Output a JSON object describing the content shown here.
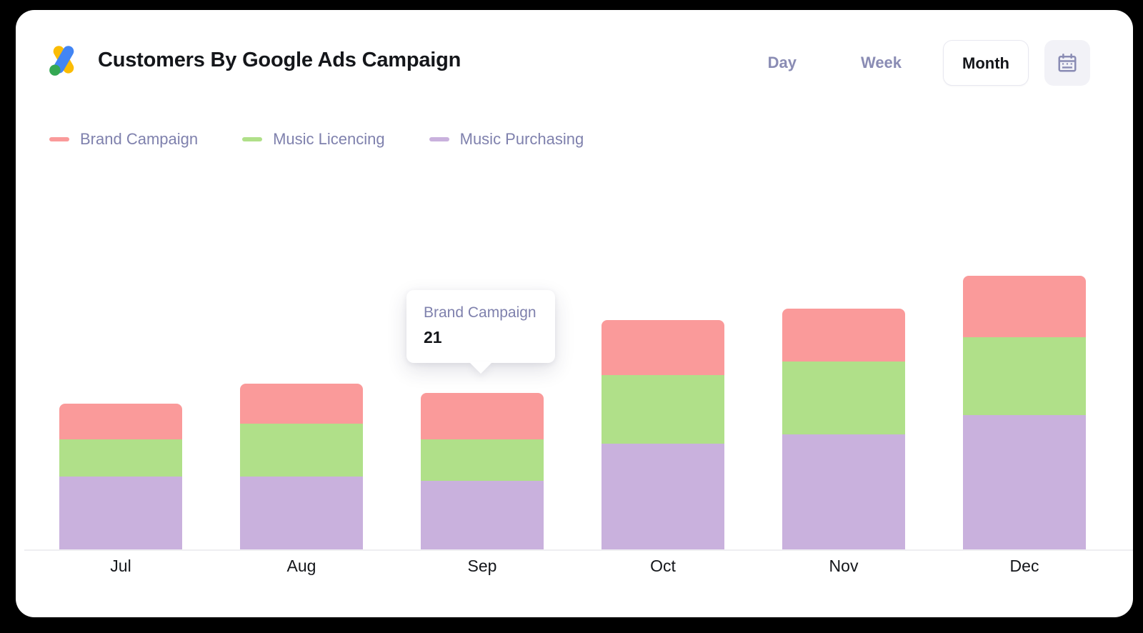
{
  "header": {
    "title": "Customers By Google Ads Campaign",
    "logo_icon": "google-ads-icon",
    "ranges": [
      {
        "label": "Day",
        "active": false
      },
      {
        "label": "Week",
        "active": false
      },
      {
        "label": "Month",
        "active": true
      }
    ],
    "calendar_icon": "calendar-icon"
  },
  "legend": [
    {
      "label": "Brand Campaign",
      "color": "#fa9a9a"
    },
    {
      "label": "Music Licencing",
      "color": "#b0e089"
    },
    {
      "label": "Music Purchasing",
      "color": "#c9b1dd"
    }
  ],
  "tooltip": {
    "series": "Brand Campaign",
    "value": "21",
    "anchor_category": "Sep"
  },
  "colors": {
    "brand_campaign": "#fa9a9a",
    "music_licencing": "#b0e089",
    "music_purchasing": "#c9b1dd",
    "axis": "#eeeef1",
    "muted_text": "#7f81ad",
    "active_text": "#14161a",
    "card_bg": "#ffffff",
    "page_bg": "#000000"
  },
  "chart_data": {
    "type": "bar",
    "stacked": true,
    "title": "Customers By Google Ads Campaign",
    "xlabel": "",
    "ylabel": "",
    "grid": false,
    "legend_position": "top-left",
    "axis_range_note": "no y-axis tick labels rendered",
    "categories": [
      "Jul",
      "Aug",
      "Sep",
      "Oct",
      "Nov",
      "Dec"
    ],
    "series": [
      {
        "name": "Music Purchasing",
        "color": "#c9b1dd",
        "values": [
          33,
          33,
          31,
          48,
          52,
          61
        ]
      },
      {
        "name": "Music Licencing",
        "color": "#b0e089",
        "values": [
          17,
          24,
          19,
          31,
          33,
          35
        ]
      },
      {
        "name": "Brand Campaign",
        "color": "#fa9a9a",
        "values": [
          16,
          18,
          21,
          25,
          24,
          28
        ]
      }
    ],
    "totals": [
      66,
      75,
      71,
      104,
      109,
      124
    ]
  }
}
